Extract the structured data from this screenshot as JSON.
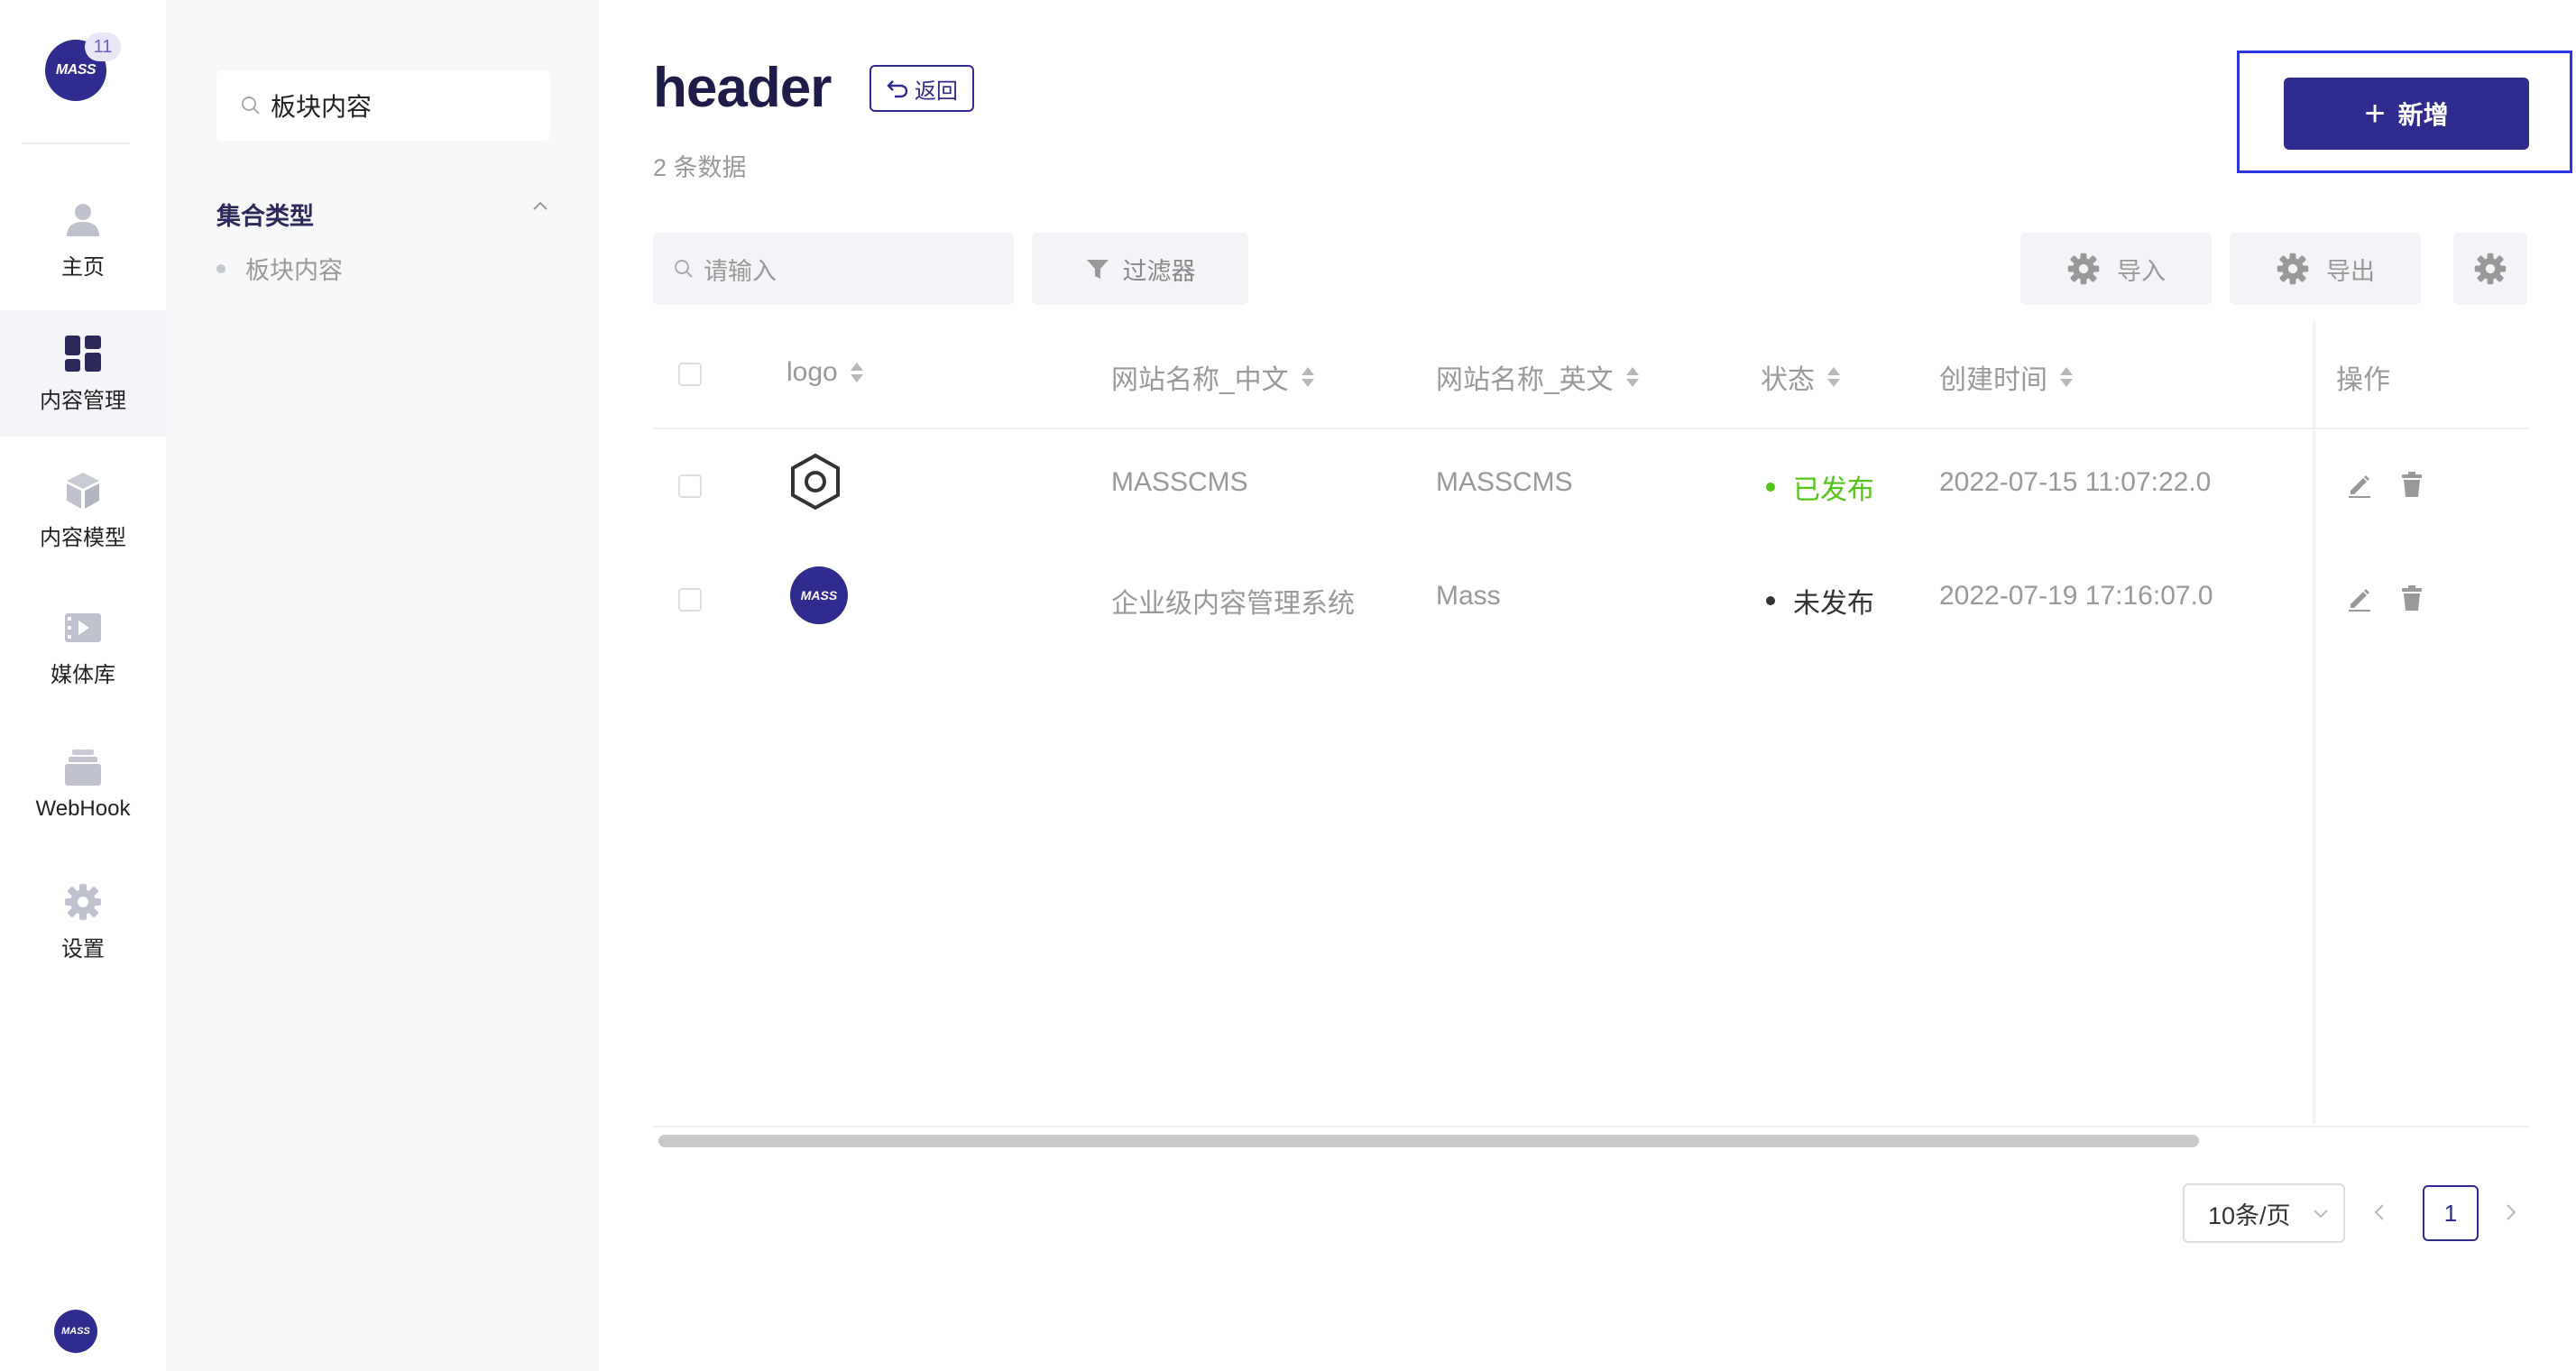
{
  "nav": {
    "logo_text": "MASS",
    "badge": "11",
    "items": [
      {
        "label": "主页",
        "icon": "user-icon"
      },
      {
        "label": "内容管理",
        "icon": "dashboard-icon"
      },
      {
        "label": "内容模型",
        "icon": "cube-icon"
      },
      {
        "label": "媒体库",
        "icon": "media-icon"
      },
      {
        "label": "WebHook",
        "icon": "archive-icon"
      },
      {
        "label": "设置",
        "icon": "gear-icon"
      }
    ],
    "avatar_text": "MASS"
  },
  "panel": {
    "search_value": "板块内容",
    "group_title": "集合类型",
    "items": [
      {
        "label": "板块内容"
      }
    ]
  },
  "header": {
    "title": "header",
    "back_label": "返回",
    "count_text": "2 条数据",
    "add_label": "新增"
  },
  "toolbar": {
    "search_placeholder": "请输入",
    "filter_label": "过滤器",
    "import_label": "导入",
    "export_label": "导出"
  },
  "table": {
    "columns": [
      "logo",
      "网站名称_中文",
      "网站名称_英文",
      "状态",
      "创建时间",
      "操作"
    ],
    "rows": [
      {
        "logo": "hex-logo-icon",
        "name_cn": "MASSCMS",
        "name_en": "MASSCMS",
        "status": "已发布",
        "created": "2022-07-15 11:07:22.0"
      },
      {
        "logo": "MASS",
        "name_cn": "企业级内容管理系统",
        "name_en": "Mass",
        "status": "未发布",
        "created": "2022-07-19 17:16:07.0"
      }
    ]
  },
  "colors": {
    "brand": "#2f2b8f",
    "published": "#52c41a",
    "unpublished": "#333333",
    "highlight_frame": "#2c36e0"
  },
  "pagination": {
    "page_size_label": "10条/页",
    "current_page": "1"
  }
}
